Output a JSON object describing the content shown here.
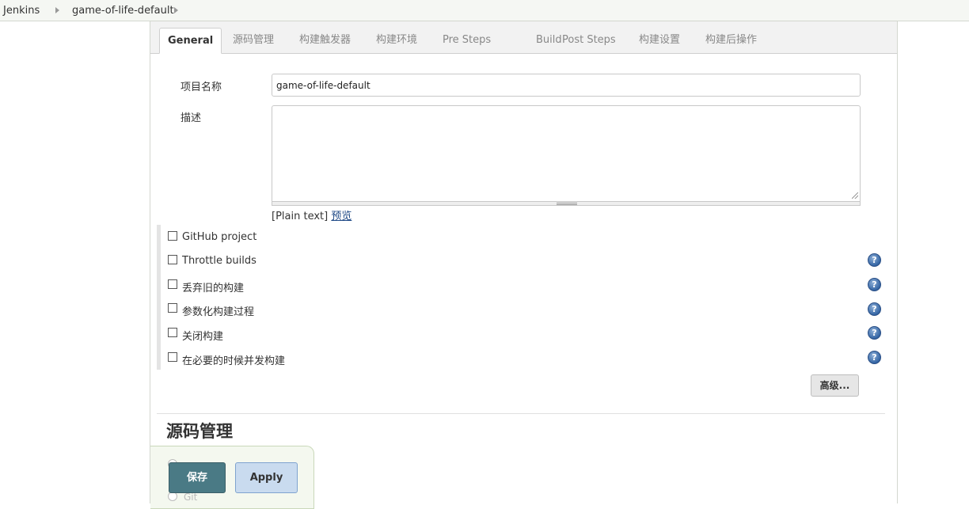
{
  "breadcrumb": {
    "items": [
      {
        "label": "Jenkins"
      },
      {
        "label": "game-of-life-default"
      }
    ]
  },
  "tabs": [
    {
      "label": "General",
      "active": true
    },
    {
      "label": "源码管理"
    },
    {
      "label": "构建触发器"
    },
    {
      "label": "构建环境"
    },
    {
      "label": "Pre Steps"
    },
    {
      "label": "Build"
    },
    {
      "label": "Post Steps"
    },
    {
      "label": "构建设置"
    },
    {
      "label": "构建后操作"
    }
  ],
  "general": {
    "project_name_label": "项目名称",
    "project_name_value": "game-of-life-default",
    "description_label": "描述",
    "description_value": "",
    "markup_format": "[Plain text]",
    "preview_link": "预览"
  },
  "options": [
    {
      "label": "GitHub project",
      "checked": false,
      "help": false
    },
    {
      "label": "Throttle builds",
      "checked": false,
      "help": true
    },
    {
      "label": "丢弃旧的构建",
      "checked": false,
      "help": true
    },
    {
      "label": "参数化构建过程",
      "checked": false,
      "help": true
    },
    {
      "label": "关闭构建",
      "checked": false,
      "help": true
    },
    {
      "label": "在必要的时候并发构建",
      "checked": false,
      "help": true
    }
  ],
  "advanced_button": "高级...",
  "scm_section": {
    "title": "源码管理",
    "git_option": "Git"
  },
  "actions": {
    "save_label": "保存",
    "apply_label": "Apply"
  },
  "help_icon_glyph": "?",
  "icons": {
    "crumb_separator": "chevron-right-icon",
    "help": "help-icon"
  },
  "colors": {
    "save_button": "#4a7a85",
    "apply_button": "#c9dbef",
    "link": "#204a87",
    "help_icon": "#3465a4"
  }
}
